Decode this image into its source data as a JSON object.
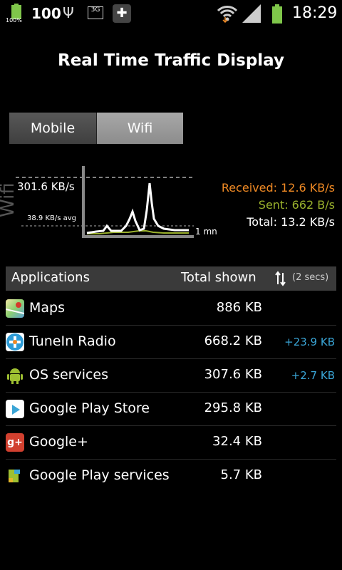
{
  "status_bar": {
    "battery_small_label": "100%",
    "battery_level": "100",
    "network_type": "3G",
    "time": "18:29",
    "icons": [
      "battery-icon",
      "usb-icon",
      "3g-data-icon",
      "tunein-notification-icon",
      "wifi-icon",
      "signal-icon",
      "battery-icon"
    ]
  },
  "title": "Real Time Traffic Display",
  "toggle": {
    "mobile_label": "Mobile",
    "wifi_label": "Wifi",
    "selected": "Wifi"
  },
  "graph": {
    "vertical_label": "Wifi",
    "peak_label": "301.6 KB/s",
    "avg_label": "38.9 KB/s avg",
    "time_label": "1 mn"
  },
  "stats": {
    "received": "Received: 12.6 KB/s",
    "sent": "Sent: 662 B/s",
    "total": "Total: 13.2 KB/s",
    "colors": {
      "received": "#f08a24",
      "sent": "#9ab12c",
      "total": "#ffffff"
    }
  },
  "table": {
    "header": {
      "applications": "Applications",
      "total_shown": "Total shown",
      "interval": "(2 secs)"
    },
    "rows": [
      {
        "icon": "maps-icon",
        "name": "Maps",
        "total": "886 KB",
        "delta": ""
      },
      {
        "icon": "tunein-icon",
        "name": "TuneIn Radio",
        "total": "668.2 KB",
        "delta": "+23.9 KB"
      },
      {
        "icon": "android-icon",
        "name": "OS services",
        "total": "307.6 KB",
        "delta": "+2.7 KB"
      },
      {
        "icon": "play-store-icon",
        "name": "Google Play Store",
        "total": "295.8 KB",
        "delta": ""
      },
      {
        "icon": "google-plus-icon",
        "name": "Google+",
        "total": "32.4 KB",
        "delta": ""
      },
      {
        "icon": "play-services-icon",
        "name": "Google Play services",
        "total": "5.7 KB",
        "delta": ""
      }
    ]
  },
  "accent_color": "#3aa5d6"
}
